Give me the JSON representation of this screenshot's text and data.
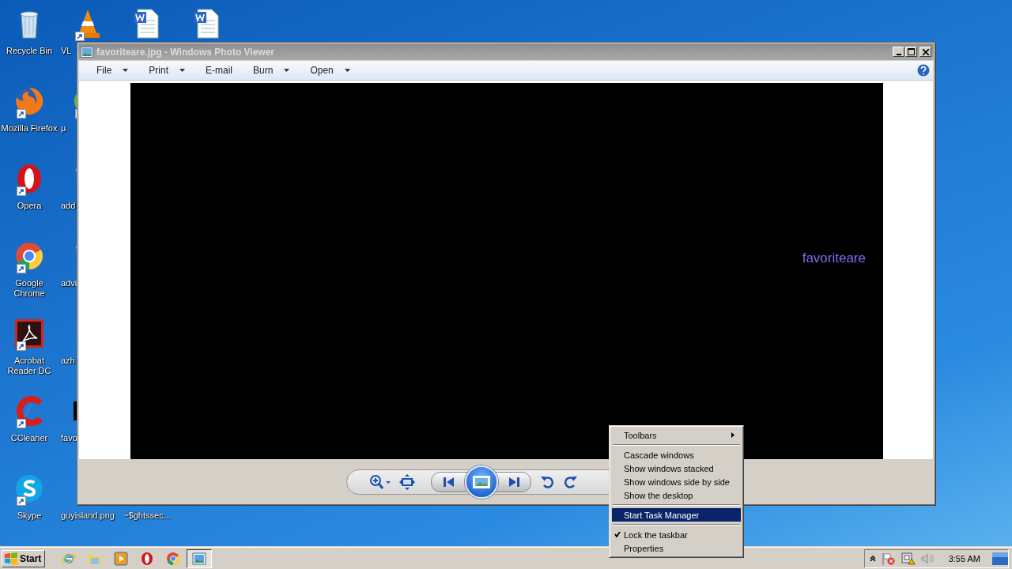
{
  "desktop": {
    "columns": [
      {
        "icons": [
          {
            "label": "Recycle Bin",
            "kind": "recycle",
            "shortcut": false
          },
          {
            "label": "Mozilla Firefox",
            "kind": "firefox",
            "shortcut": true
          },
          {
            "label": "Opera",
            "kind": "opera",
            "shortcut": true
          },
          {
            "label": "Google Chrome",
            "kind": "chrome",
            "shortcut": true
          },
          {
            "label": "Acrobat Reader DC",
            "kind": "acrobat",
            "shortcut": true
          },
          {
            "label": "CCleaner",
            "kind": "ccleaner",
            "shortcut": true
          },
          {
            "label": "Skype",
            "kind": "skype",
            "shortcut": true
          }
        ]
      },
      {
        "icons": [
          {
            "label": "VL",
            "kind": "vlc",
            "shortcut": true
          },
          {
            "label": "µ",
            "kind": "torrent",
            "shortcut": true
          },
          {
            "label": "add",
            "kind": "word",
            "shortcut": false
          },
          {
            "label": "advi",
            "kind": "word",
            "shortcut": false
          },
          {
            "label": "azh",
            "kind": "blank",
            "shortcut": false
          },
          {
            "label": "favo",
            "kind": "thumb",
            "shortcut": false
          },
          {
            "label": "guyisland.png",
            "kind": "blank",
            "shortcut": false
          }
        ]
      },
      {
        "icons": [
          {
            "kind": "word",
            "shortcut": false
          },
          {
            "label": "~$ghtssec...",
            "kind": "blank",
            "shortcut": false
          }
        ]
      },
      {
        "icons": [
          {
            "kind": "word",
            "shortcut": false
          }
        ]
      }
    ]
  },
  "window": {
    "title": "favoriteare.jpg - Windows Photo Viewer",
    "active": false,
    "menu": [
      {
        "label": "File",
        "dropdown": true
      },
      {
        "label": "Print",
        "dropdown": true
      },
      {
        "label": "E-mail",
        "dropdown": false
      },
      {
        "label": "Burn",
        "dropdown": true
      },
      {
        "label": "Open",
        "dropdown": true
      }
    ],
    "image_text": "favoriteare"
  },
  "context_menu": {
    "items": [
      {
        "kind": "item",
        "label": "Toolbars",
        "submenu": true,
        "checked": false,
        "selected": false
      },
      {
        "kind": "separator"
      },
      {
        "kind": "item",
        "label": "Cascade windows",
        "submenu": false,
        "checked": false,
        "selected": false
      },
      {
        "kind": "item",
        "label": "Show windows stacked",
        "submenu": false,
        "checked": false,
        "selected": false
      },
      {
        "kind": "item",
        "label": "Show windows side by side",
        "submenu": false,
        "checked": false,
        "selected": false
      },
      {
        "kind": "item",
        "label": "Show the desktop",
        "submenu": false,
        "checked": false,
        "selected": false
      },
      {
        "kind": "separator"
      },
      {
        "kind": "item",
        "label": "Start Task Manager",
        "submenu": false,
        "checked": false,
        "selected": true
      },
      {
        "kind": "separator"
      },
      {
        "kind": "item",
        "label": "Lock the taskbar",
        "submenu": false,
        "checked": true,
        "selected": false
      },
      {
        "kind": "item",
        "label": "Properties",
        "submenu": false,
        "checked": false,
        "selected": false
      }
    ]
  },
  "taskbar": {
    "start": "Start",
    "buttons": [
      {
        "kind": "ie",
        "active": false
      },
      {
        "kind": "folder",
        "active": false
      },
      {
        "kind": "media",
        "active": false
      },
      {
        "kind": "opera",
        "active": false
      },
      {
        "kind": "chrome",
        "active": false
      },
      {
        "kind": "photo",
        "active": true
      }
    ],
    "clock": "3:55 AM"
  }
}
